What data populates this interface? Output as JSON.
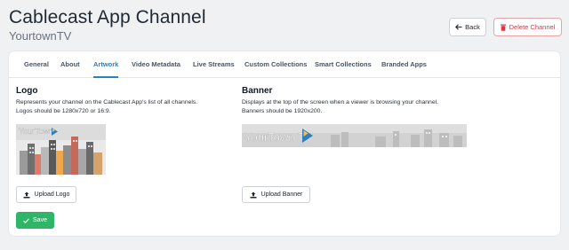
{
  "header": {
    "title": "Cablecast App Channel",
    "subtitle": "YourtownTV"
  },
  "actions": {
    "back_label": "Back",
    "delete_label": "Delete Channel"
  },
  "tabs": [
    {
      "label": "General"
    },
    {
      "label": "About"
    },
    {
      "label": "Artwork"
    },
    {
      "label": "Video Metadata"
    },
    {
      "label": "Live Streams"
    },
    {
      "label": "Custom Collections"
    },
    {
      "label": "Smart Collections"
    },
    {
      "label": "Branded Apps"
    }
  ],
  "active_tab": "Artwork",
  "logo": {
    "title": "Logo",
    "description_line1": "Represents your channel on the Cablecast App's list of all channels.",
    "description_line2": "Logos should be 1280x720 or 16:9.",
    "image_text": "YourTown",
    "upload_label": "Upload Logo"
  },
  "banner": {
    "title": "Banner",
    "description_line1": "Displays at the top of the screen when a viewer is browsing your channel.",
    "description_line2": "Banners should be 1920x200.",
    "image_text": "YourTown TV",
    "upload_label": "Upload Banner"
  },
  "save_label": "Save",
  "colors": {
    "accent": "#2f7ebd",
    "danger": "#dc3545",
    "success": "#2fb567"
  }
}
